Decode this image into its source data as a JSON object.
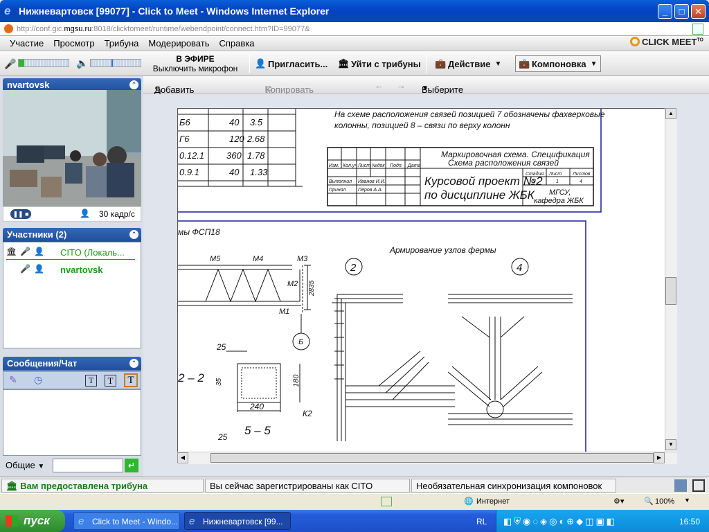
{
  "window": {
    "title": "Нижневартовск [99077] - Click to Meet - Windows Internet Explorer",
    "url_prefix": "http://conf.gic.",
    "url_domain": "mgsu.ru",
    "url_rest": ":8018/clicktomeet/runtime/webendpoint/connect.htm?ID=99077&"
  },
  "menu": [
    "Участие",
    "Просмотр",
    "Трибуна",
    "Модерировать",
    "Справка"
  ],
  "brand": "CLICK MEET",
  "brand_sup": "TO",
  "toolbar": {
    "live_title": "В ЭФИРЕ",
    "live_sub": "Выключить микрофон",
    "invite": "Пригласить...",
    "leave": "Уйти с трибуны",
    "action": "Действие",
    "layout": "Компоновка"
  },
  "video": {
    "user": "nvartovsk",
    "fps": "30 кадр/с"
  },
  "participants": {
    "header": "Участники (2)",
    "items": [
      {
        "name": "CITO (Локаль...",
        "color": "#1a9a1a"
      },
      {
        "name": "nvartovsk",
        "color": "#1a9a1a"
      }
    ]
  },
  "chat": {
    "header": "Сообщения/Чат",
    "scope": "Общие"
  },
  "doc_toolbar": {
    "annotate": "Добавить аннотацию",
    "copy": "Копировать в буфер",
    "select": "Выберите документ..."
  },
  "drawing": {
    "note1": "На схеме расположения связей позицией 7 обозначены фахверковые",
    "note2": "колонны, позицией 8 – связи по верху колонн",
    "table_rows": [
      [
        "Б6",
        "40",
        "3.5"
      ],
      [
        "Г6",
        "120",
        "2.68"
      ],
      [
        "0.12.1",
        "360",
        "1.78"
      ],
      [
        "0.9.1",
        "40",
        "1.33"
      ]
    ],
    "stamp_title1": "Маркировочная схема. Спецификация",
    "stamp_title2": "Схема расположения связей",
    "stamp_headers": [
      "Изм.",
      "Кол.уч",
      "Лист",
      "№док",
      "Подп.",
      "Дата"
    ],
    "stamp_rows": [
      [
        "Выполнил",
        "Иванов И.И."
      ],
      [
        "Принял",
        "Перов А.А."
      ]
    ],
    "project1": "Курсовой проект №2",
    "project2": "по дисциплине ЖБК",
    "stage_h": [
      "Стадия",
      "Лист",
      "Листов"
    ],
    "stage_v": [
      "У",
      "1",
      "4"
    ],
    "org1": "МГСУ,",
    "org2": "кафедра ЖБК",
    "truss_title": "мы ФСП18",
    "node_title": "Армирование узлов фермы",
    "node_a": "2",
    "node_b": "4",
    "marks": [
      "М5",
      "М4",
      "М3",
      "М2",
      "М1",
      "2835",
      "Б"
    ],
    "sec_label": "2 – 2",
    "sec2": "5 – 5",
    "dims": [
      "25",
      "35",
      "180",
      "240",
      "К2",
      "25"
    ]
  },
  "status": {
    "tribune": "Вам предоставлена трибуна",
    "registered": "Вы сейчас зарегистрированы как CITO",
    "sync": "Необязательная синхронизация компоновок"
  },
  "ie": {
    "zone": "Интернет",
    "zoom": "100%"
  },
  "taskbar": {
    "start": "пуск",
    "tasks": [
      "Click to Meet - Windo...",
      "Нижневартовск [99..."
    ],
    "lang": "RL",
    "time": "16:50"
  }
}
